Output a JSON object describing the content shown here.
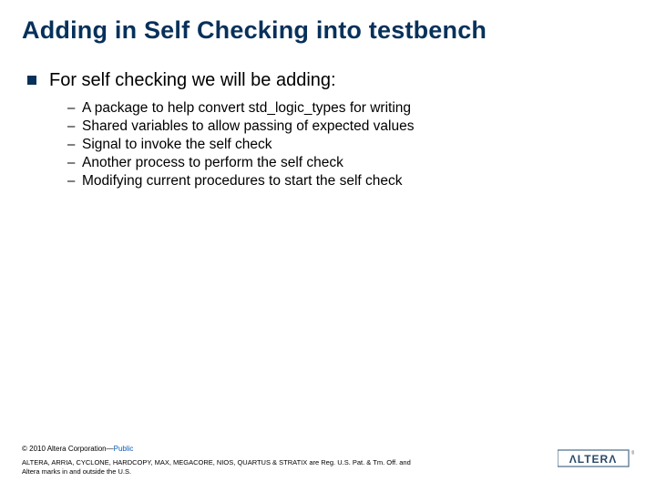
{
  "title": "Adding in Self Checking into testbench",
  "lvl1_text": "For self checking we will be adding:",
  "subitems": {
    "0": "A package to help convert std_logic_types for writing",
    "1": "Shared variables to allow passing of expected values",
    "2": "Signal to invoke the self check",
    "3": "Another process to perform the self check",
    "4": "Modifying current procedures to start the self check"
  },
  "footer": {
    "copyright_prefix": "© 2010 Altera Corporation—",
    "copyright_public": "Public",
    "trademark": "ALTERA, ARRIA, CYCLONE, HARDCOPY, MAX, MEGACORE, NIOS, QUARTUS & STRATIX are Reg. U.S. Pat. & Tm. Off. and Altera marks in and outside the U.S."
  },
  "logo": {
    "name": "ALTERA"
  }
}
